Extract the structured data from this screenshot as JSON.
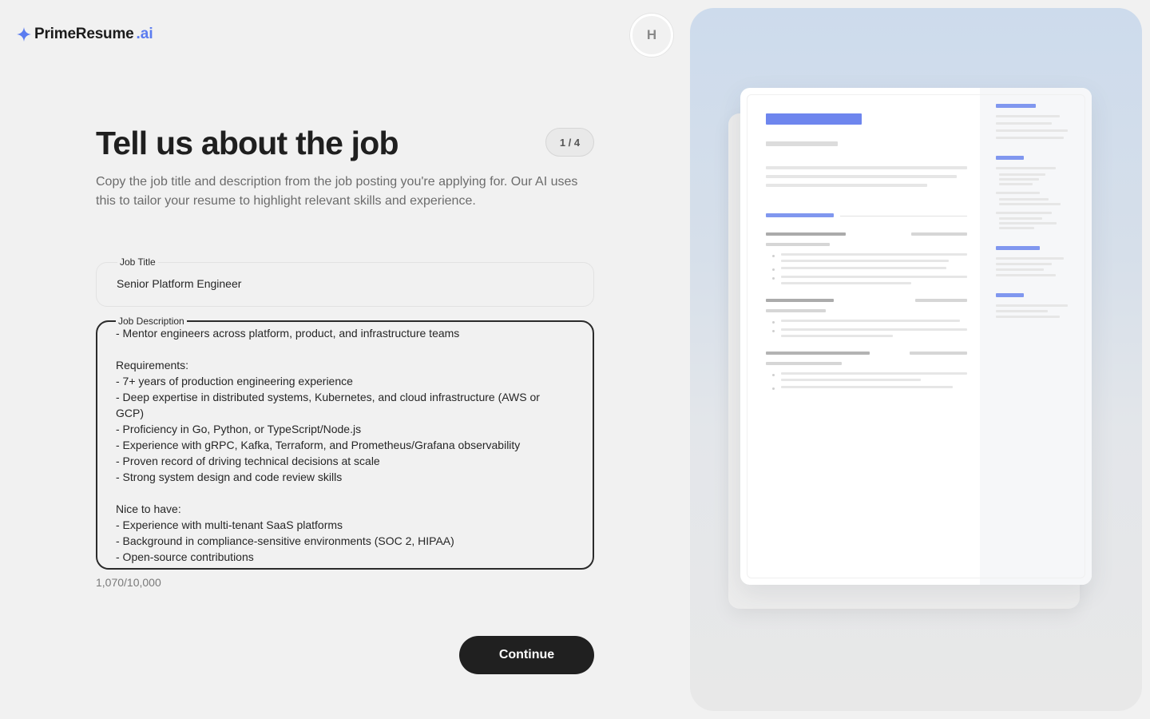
{
  "brand": {
    "name": "PrimeResume",
    "tld": ".ai",
    "icon": "sparkle-icon",
    "accent": "#5b7cf0"
  },
  "user": {
    "initial": "H"
  },
  "header": {
    "title": "Tell us about the job",
    "step": "1 / 4",
    "subtitle": "Copy the job title and description from the job posting you're applying for. Our AI uses this to tailor your resume to highlight relevant skills and experience."
  },
  "form": {
    "job_title": {
      "label": "Job Title",
      "value": "Senior Platform Engineer"
    },
    "job_description": {
      "label": "Job Description",
      "value": "- Mentor engineers across platform, product, and infrastructure teams\n\nRequirements:\n- 7+ years of production engineering experience\n- Deep expertise in distributed systems, Kubernetes, and cloud infrastructure (AWS or GCP)\n- Proficiency in Go, Python, or TypeScript/Node.js\n- Experience with gRPC, Kafka, Terraform, and Prometheus/Grafana observability\n- Proven record of driving technical decisions at scale\n- Strong system design and code review skills\n\nNice to have:\n- Experience with multi-tenant SaaS platforms\n- Background in compliance-sensitive environments (SOC 2, HIPAA)\n- Open-source contributions"
    },
    "char_count": "1,070/10,000"
  },
  "actions": {
    "continue_label": "Continue"
  },
  "colors": {
    "primary_button": "#202020",
    "preview_accent": "#8097ef"
  }
}
